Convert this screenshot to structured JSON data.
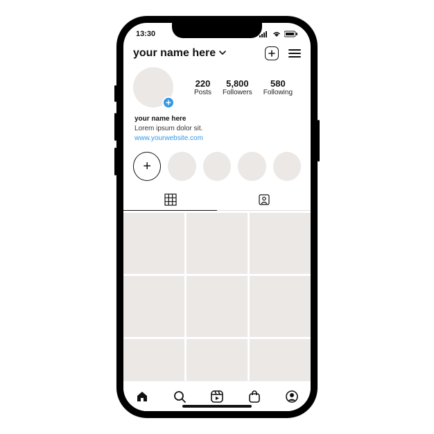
{
  "status": {
    "time": "13:30"
  },
  "header": {
    "username": "your name here"
  },
  "stats": {
    "posts": {
      "value": "220",
      "label": "Posts"
    },
    "followers": {
      "value": "5,800",
      "label": "Followers"
    },
    "following": {
      "value": "580",
      "label": "Following"
    }
  },
  "bio": {
    "name": "your name here",
    "text": "Lorem ipsum dolor sit.",
    "link": "www.yourwebsite.com"
  },
  "highlights": {
    "new_glyph": "+"
  },
  "grid_count": 9
}
